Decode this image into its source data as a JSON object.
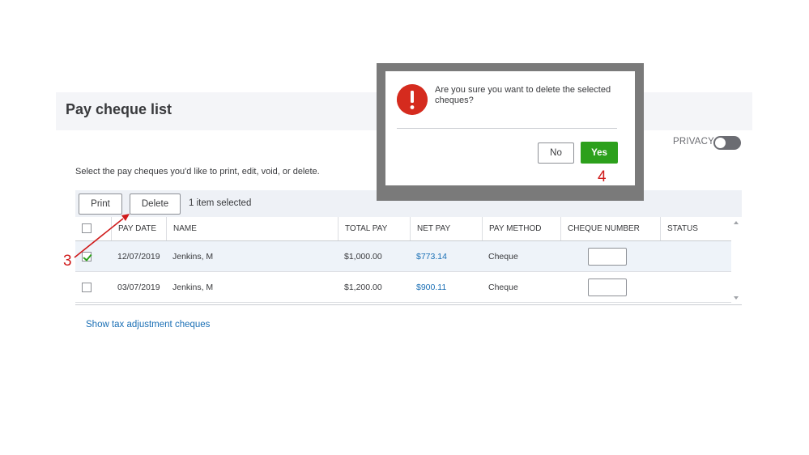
{
  "page": {
    "title": "Pay cheque list",
    "instructions": "Select the pay cheques you'd like to print, edit, void, or delete.",
    "privacy_label": "PRIVACY"
  },
  "toolbar": {
    "print_label": "Print",
    "delete_label": "Delete",
    "selected_count": "1 item selected"
  },
  "table": {
    "headers": {
      "pay_date": "PAY DATE",
      "name": "NAME",
      "total_pay": "TOTAL PAY",
      "net_pay": "NET PAY",
      "pay_method": "PAY METHOD",
      "cheque_number": "CHEQUE NUMBER",
      "status": "STATUS"
    },
    "rows": [
      {
        "checked": true,
        "pay_date": "12/07/2019",
        "name": "Jenkins, M",
        "total_pay": "$1,000.00",
        "net_pay": "$773.14",
        "pay_method": "Cheque",
        "cheque_number": "",
        "status": ""
      },
      {
        "checked": false,
        "pay_date": "03/07/2019",
        "name": "Jenkins, M",
        "total_pay": "$1,200.00",
        "net_pay": "$900.11",
        "pay_method": "Cheque",
        "cheque_number": "",
        "status": ""
      }
    ]
  },
  "footer": {
    "tax_link": "Show tax adjustment cheques"
  },
  "dialog": {
    "message": "Are you sure you want to delete the selected cheques?",
    "no_label": "No",
    "yes_label": "Yes"
  },
  "annotations": {
    "step_3": "3",
    "step_4": "4"
  },
  "colors": {
    "accent_green": "#2ca01c",
    "alert_red": "#d52b1e",
    "annotation_red": "#d01b1b",
    "link_blue": "#1a6fb5"
  }
}
